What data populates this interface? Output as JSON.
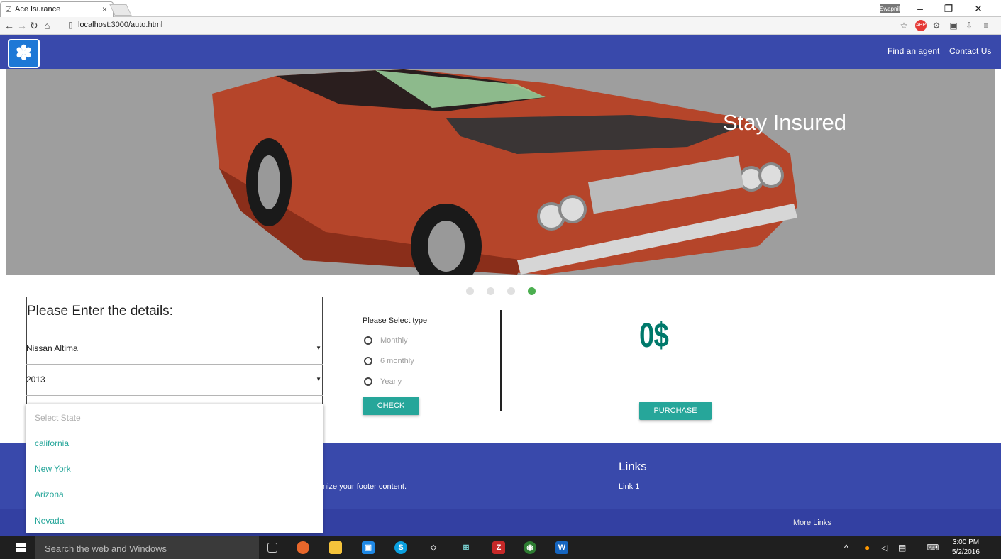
{
  "browser": {
    "tab_title": "Ace Isurance",
    "tab_close": "×",
    "user_badge": "Swapnil",
    "window_buttons": [
      "–",
      "❐",
      "✕"
    ],
    "nav_icons": [
      "back-icon",
      "forward-icon",
      "reload-icon",
      "home-icon"
    ],
    "url": "localhost:3000/auto.html",
    "extension_icons": [
      "star-icon",
      "adblock-icon",
      "settings-icon",
      "extension-icon",
      "download-icon",
      "menu-icon"
    ]
  },
  "navbar": {
    "links": [
      "Find an agent",
      "Contact Us"
    ]
  },
  "hero": {
    "caption": "Stay Insured",
    "slides": 4,
    "active_slide": 4
  },
  "form": {
    "title": "Please Enter the details:",
    "car_model": "Nissan Altima",
    "year": "2013",
    "state_placeholder": "Select State",
    "state_options": [
      "california",
      "New York",
      "Arizona",
      "Nevada"
    ]
  },
  "plan": {
    "label": "Please Select type",
    "options": [
      "Monthly",
      "6 monthly",
      "Yearly"
    ],
    "check_button": "CHECK"
  },
  "quote": {
    "price": "0$",
    "purchase_button": "PURCHASE"
  },
  "footer": {
    "fragment": "nize your footer content.",
    "links_title": "Links",
    "link1": "Link 1",
    "more_links": "More Links"
  },
  "taskbar": {
    "search_placeholder": "Search the web and Windows",
    "time": "3:00 PM",
    "date": "5/2/2016"
  },
  "colors": {
    "navbar": "#3949ab",
    "accent": "#26a69a",
    "price": "#00796b",
    "active_dot": "#4caf50"
  }
}
